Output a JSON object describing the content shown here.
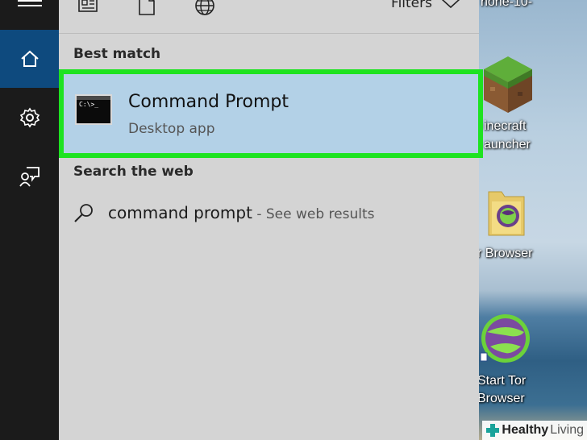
{
  "search_panel": {
    "filters_label": "Filters",
    "best_match_heading": "Best match",
    "best_match_item": {
      "title": "Command Prompt",
      "subtitle": "Desktop app",
      "icon_text": "C:\\>_"
    },
    "web_heading": "Search the web",
    "web_result": {
      "query": "command prompt",
      "suffix": " - See web results"
    }
  },
  "desktop": {
    "icons": [
      {
        "label": "hone-10-",
        "icon": "document-icon"
      },
      {
        "label_line1": "inecraft",
        "label_line2": "auncher",
        "icon": "minecraft-icon"
      },
      {
        "label": "r Browser",
        "icon": "tor-folder-icon"
      },
      {
        "label_line1": "Start Tor",
        "label_line2": "Browser",
        "icon": "tor-globe-icon"
      }
    ]
  },
  "watermark": {
    "brand_bold": "Healthy",
    "brand_thin": "Living"
  },
  "colors": {
    "rail_bg": "#1b1b1b",
    "rail_active": "#0e4a7e",
    "panel_bg": "#d4d4d4",
    "selected_bg": "#b3d1e7",
    "highlight_border": "#1ee321"
  }
}
